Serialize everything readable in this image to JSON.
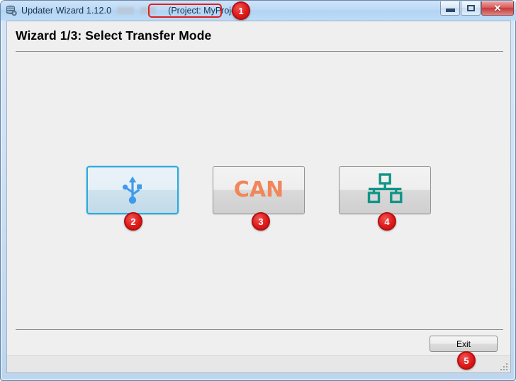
{
  "window": {
    "app_title": "Updater Wizard 1.12.0",
    "project_label": "(Project: MyProject)",
    "title_icon": "database-gear-icon",
    "controls": {
      "minimize": "minimize-icon",
      "maximize": "maximize-icon",
      "close": "✕"
    }
  },
  "page": {
    "heading": "Wizard 1/3:   Select Transfer Mode"
  },
  "modes": [
    {
      "id": "usb",
      "icon": "usb-icon",
      "label": "",
      "selected": true,
      "color": "#3f9bea"
    },
    {
      "id": "can",
      "icon": "can-text-icon",
      "label": "CAN",
      "selected": false,
      "color": "#f0865a"
    },
    {
      "id": "ethernet",
      "icon": "network-icon",
      "label": "",
      "selected": false,
      "color": "#0f9488"
    }
  ],
  "footer": {
    "exit_label": "Exit"
  },
  "annotations": [
    {
      "id": "1",
      "number": "1",
      "target": "project-name-in-title"
    },
    {
      "id": "2",
      "number": "2",
      "target": "usb-mode-button"
    },
    {
      "id": "3",
      "number": "3",
      "target": "can-mode-button"
    },
    {
      "id": "4",
      "number": "4",
      "target": "ethernet-mode-button"
    },
    {
      "id": "5",
      "number": "5",
      "target": "exit-button"
    }
  ],
  "colors": {
    "titlebar": "#b9d8f6",
    "client_bg": "#efeff0",
    "selected_border": "#2cacdd",
    "badge_red": "#e01b1b",
    "annotation_outline": "#e02020"
  }
}
